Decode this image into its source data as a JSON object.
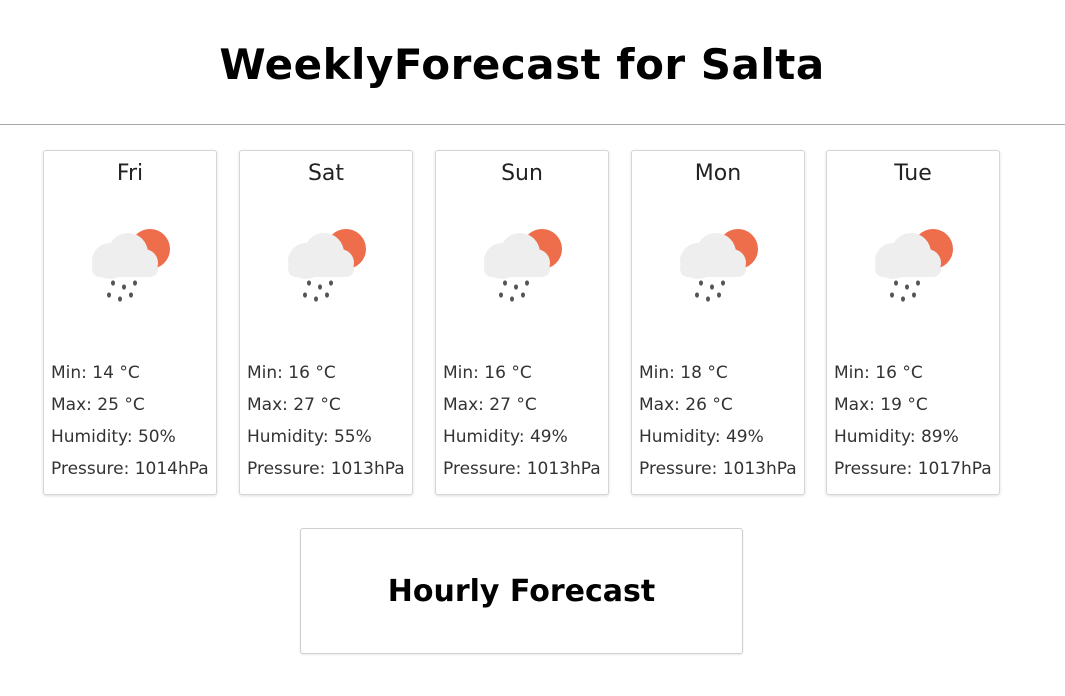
{
  "header": {
    "title": "WeeklyForecast for Salta"
  },
  "forecast": [
    {
      "day": "Fri",
      "icon": "partly-cloudy-rain-icon",
      "min": "Min: 14 °C",
      "max": "Max: 25 °C",
      "humidity": "Humidity: 50%",
      "pressure": "Pressure: 1014hPa"
    },
    {
      "day": "Sat",
      "icon": "partly-cloudy-rain-icon",
      "min": "Min: 16 °C",
      "max": "Max: 27 °C",
      "humidity": "Humidity: 55%",
      "pressure": "Pressure: 1013hPa"
    },
    {
      "day": "Sun",
      "icon": "partly-cloudy-rain-icon",
      "min": "Min: 16 °C",
      "max": "Max: 27 °C",
      "humidity": "Humidity: 49%",
      "pressure": "Pressure: 1013hPa"
    },
    {
      "day": "Mon",
      "icon": "partly-cloudy-rain-icon",
      "min": "Min: 18 °C",
      "max": "Max: 26 °C",
      "humidity": "Humidity: 49%",
      "pressure": "Pressure: 1013hPa"
    },
    {
      "day": "Tue",
      "icon": "partly-cloudy-rain-icon",
      "min": "Min: 16 °C",
      "max": "Max: 19 °C",
      "humidity": "Humidity: 89%",
      "pressure": "Pressure: 1017hPa"
    }
  ],
  "hourly": {
    "label": "Hourly Forecast"
  },
  "colors": {
    "sun": "#ee6e4c",
    "cloud": "#eeeeee",
    "rain": "#555555"
  }
}
